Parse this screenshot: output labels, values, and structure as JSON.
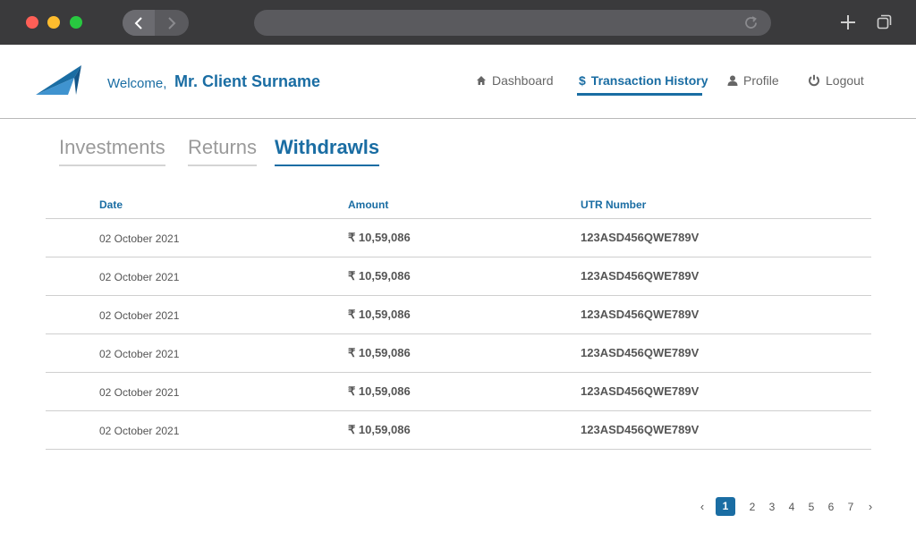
{
  "browser": {
    "back_icon": "chevron-left-icon",
    "forward_icon": "chevron-right-icon",
    "reload_icon": "reload-icon",
    "new_tab_icon": "plus-icon",
    "tabs_icon": "tabs-overview-icon"
  },
  "header": {
    "logo_icon": "paper-plane-logo",
    "welcome": "Welcome,",
    "client_name": "Mr. Client Surname",
    "nav": [
      {
        "label": "Dashboard",
        "icon": "home-icon"
      },
      {
        "label": "Transaction History",
        "icon": "dollar-icon",
        "active": true
      },
      {
        "label": "Profile",
        "icon": "user-icon"
      },
      {
        "label": "Logout",
        "icon": "power-icon"
      }
    ]
  },
  "tabs": [
    {
      "label": "Investments"
    },
    {
      "label": "Returns"
    },
    {
      "label": "Withdrawls",
      "active": true
    }
  ],
  "table": {
    "columns": [
      "Date",
      "Amount",
      "UTR Number"
    ],
    "rows": [
      {
        "date": "02 October 2021",
        "amount": "₹ 10,59,086",
        "utr": "123ASD456QWE789V"
      },
      {
        "date": "02 October 2021",
        "amount": "₹ 10,59,086",
        "utr": "123ASD456QWE789V"
      },
      {
        "date": "02 October 2021",
        "amount": "₹ 10,59,086",
        "utr": "123ASD456QWE789V"
      },
      {
        "date": "02 October 2021",
        "amount": "₹ 10,59,086",
        "utr": "123ASD456QWE789V"
      },
      {
        "date": "02 October 2021",
        "amount": "₹ 10,59,086",
        "utr": "123ASD456QWE789V"
      },
      {
        "date": "02 October 2021",
        "amount": "₹ 10,59,086",
        "utr": "123ASD456QWE789V"
      }
    ]
  },
  "pagination": {
    "prev": "‹",
    "next": "›",
    "current": "1",
    "pages": [
      "2",
      "3",
      "4",
      "5",
      "6",
      "7"
    ]
  },
  "colors": {
    "accent": "#1a6da3",
    "chrome": "#3a3a3c"
  }
}
